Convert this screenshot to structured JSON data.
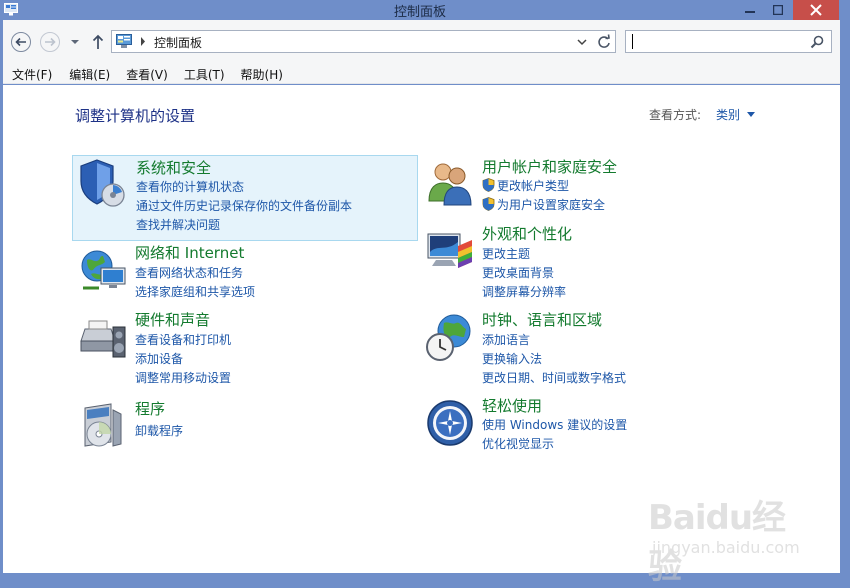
{
  "window": {
    "title": "控制面板"
  },
  "nav": {
    "address_path": "控制面板",
    "search_placeholder": ""
  },
  "menu": [
    {
      "label": "文件(F)"
    },
    {
      "label": "编辑(E)"
    },
    {
      "label": "查看(V)"
    },
    {
      "label": "工具(T)"
    },
    {
      "label": "帮助(H)"
    }
  ],
  "content": {
    "title": "调整计算机的设置",
    "view_label": "查看方式:",
    "view_value": "类别"
  },
  "categories": [
    {
      "title": "系统和安全",
      "icon": "system-security-icon",
      "links": [
        "查看你的计算机状态",
        "通过文件历史记录保存你的文件备份副本",
        "查找并解决问题"
      ]
    },
    {
      "title": "用户帐户和家庭安全",
      "icon": "user-accounts-icon",
      "links": [
        "更改帐户类型",
        "为用户设置家庭安全"
      ]
    },
    {
      "title": "网络和 Internet",
      "icon": "network-icon",
      "links": [
        "查看网络状态和任务",
        "选择家庭组和共享选项"
      ]
    },
    {
      "title": "外观和个性化",
      "icon": "appearance-icon",
      "links": [
        "更改主题",
        "更改桌面背景",
        "调整屏幕分辨率"
      ]
    },
    {
      "title": "硬件和声音",
      "icon": "hardware-sound-icon",
      "links": [
        "查看设备和打印机",
        "添加设备",
        "调整常用移动设置"
      ]
    },
    {
      "title": "时钟、语言和区域",
      "icon": "clock-language-icon",
      "links": [
        "添加语言",
        "更换输入法",
        "更改日期、时间或数字格式"
      ]
    },
    {
      "title": "程序",
      "icon": "programs-icon",
      "links": [
        "卸载程序"
      ]
    },
    {
      "title": "轻松使用",
      "icon": "ease-of-access-icon",
      "links": [
        "使用 Windows 建议的设置",
        "优化视觉显示"
      ]
    }
  ],
  "watermark": {
    "brand": "Baidu经验",
    "url": "jingyan.baidu.com"
  }
}
